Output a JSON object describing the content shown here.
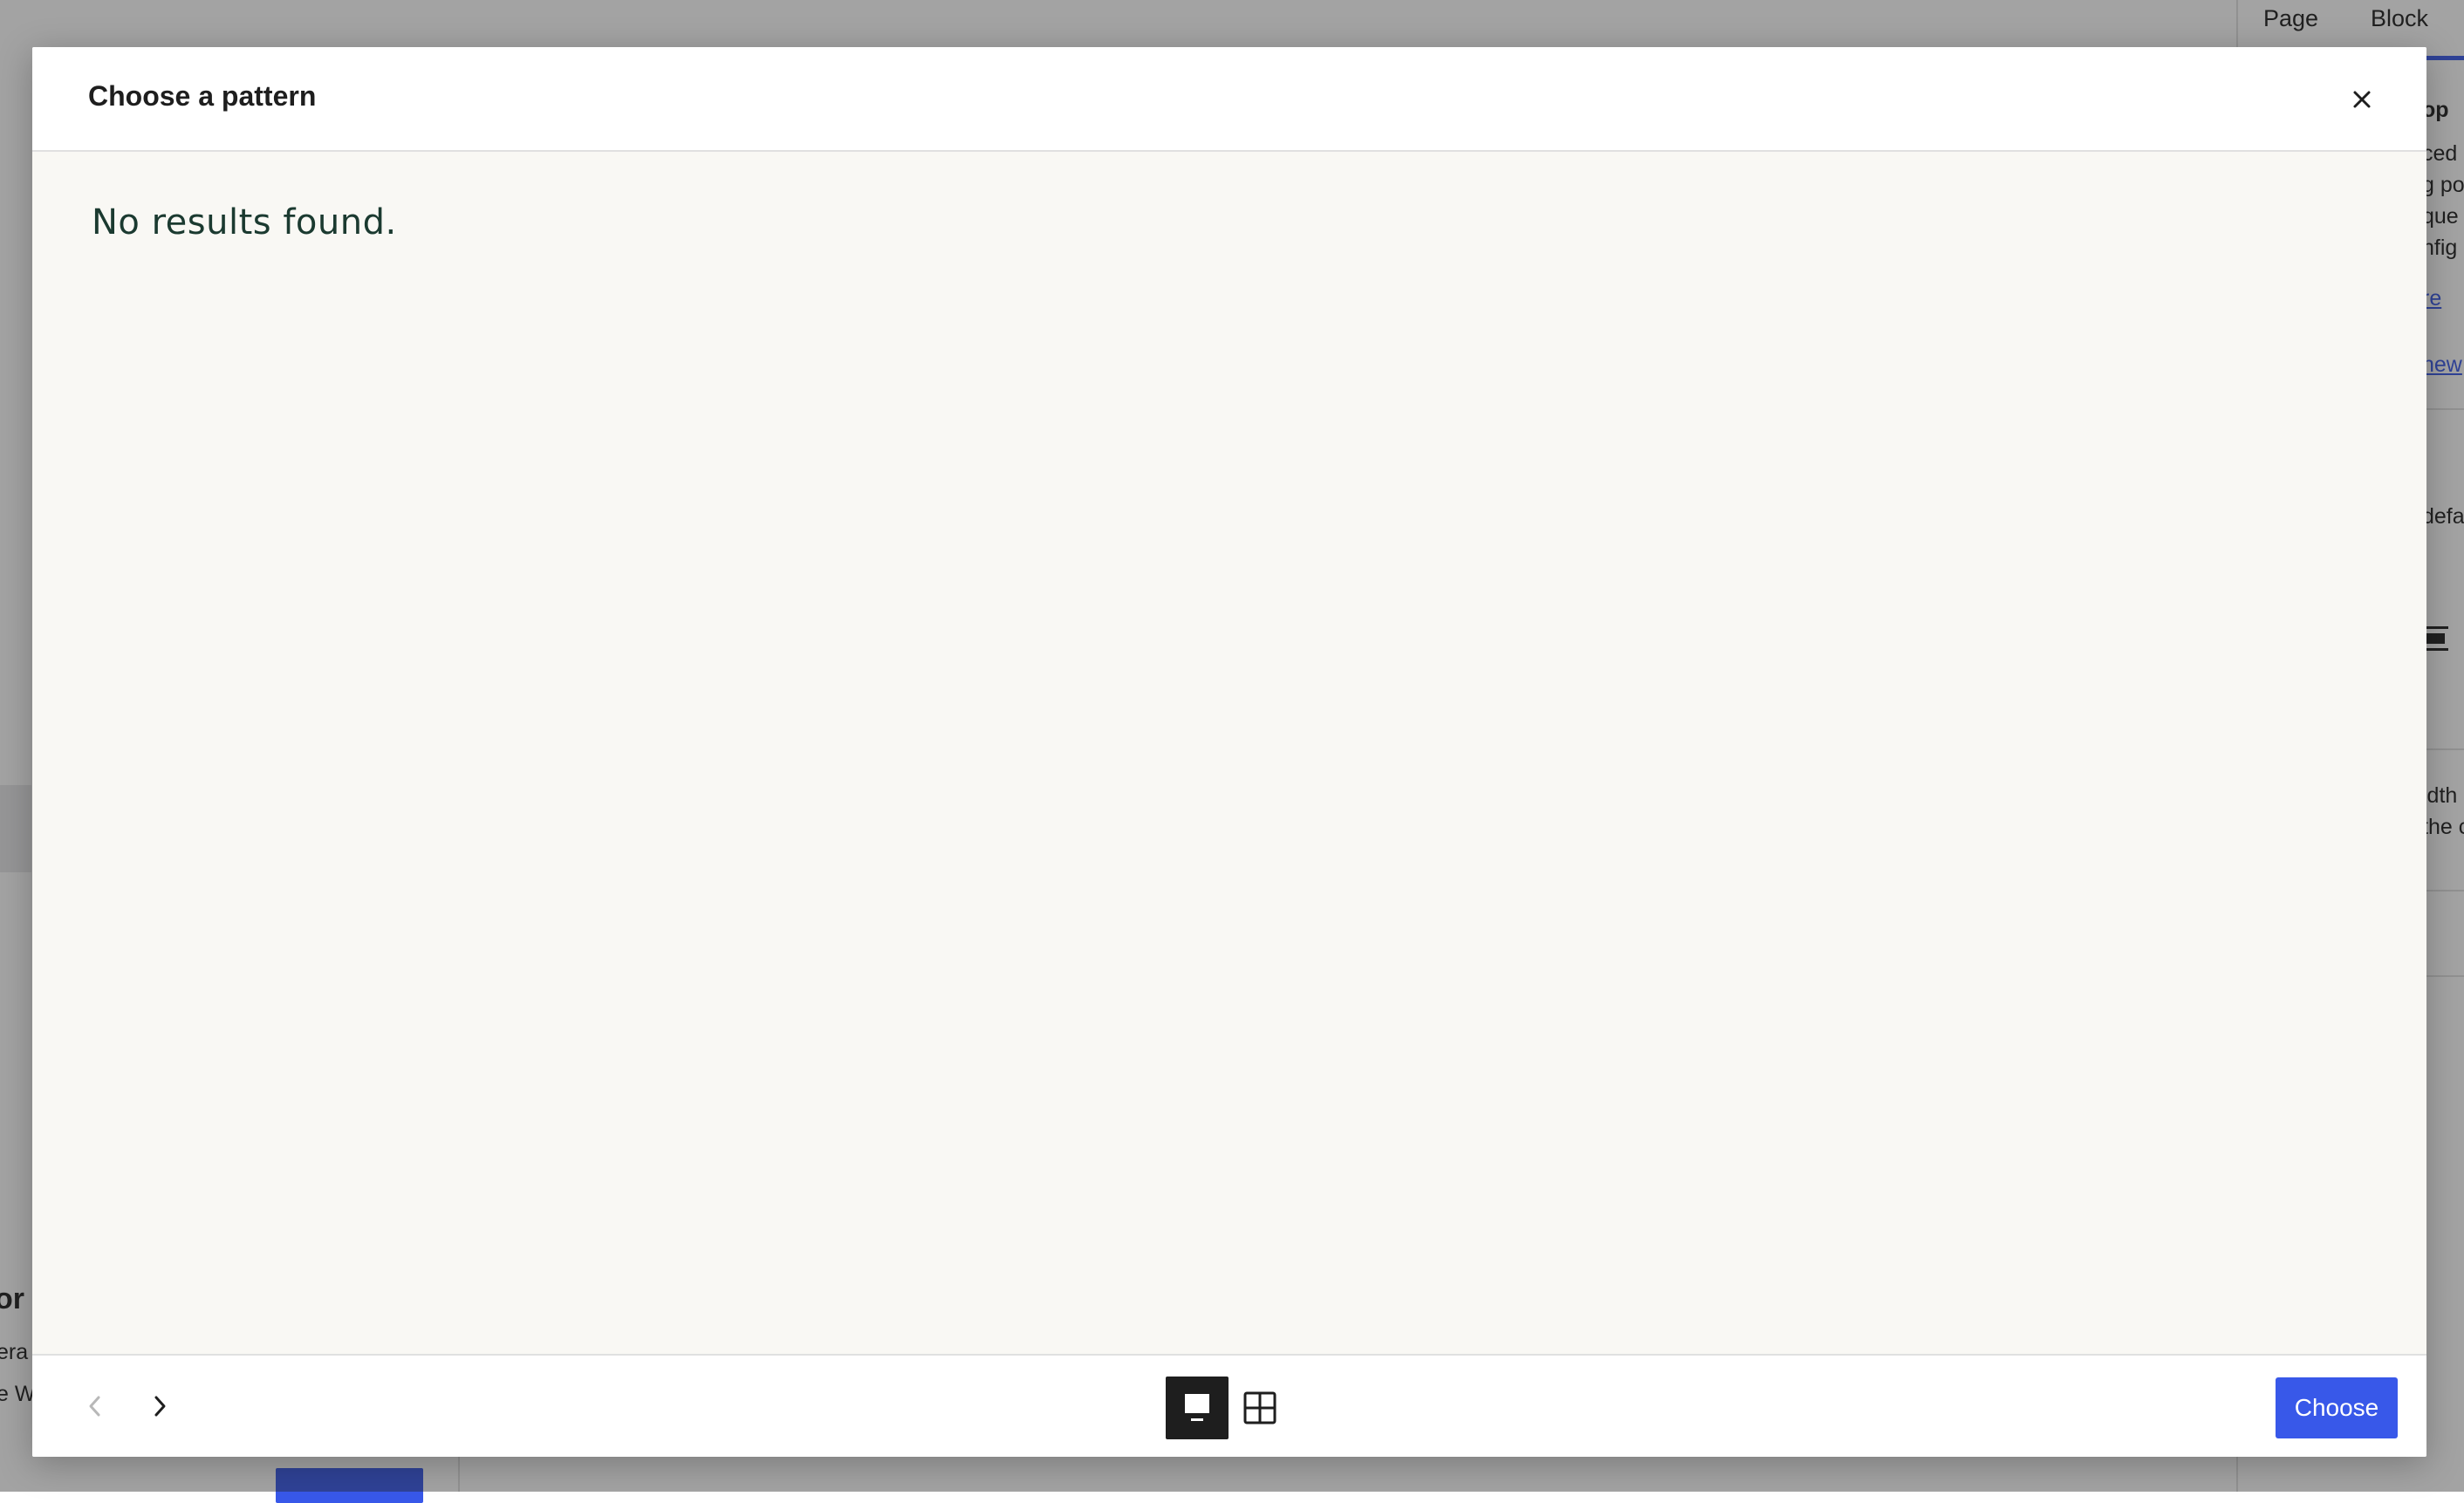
{
  "background": {
    "sidebar": {
      "tabs": [
        "Page",
        "Block"
      ],
      "fragments": {
        "top_label": "op",
        "line1": "ced",
        "line2": "g po",
        "line3": "que",
        "line4": "nfig",
        "link1": "re",
        "link2": "new",
        "default_text": "defa",
        "width_line1": "idth",
        "width_line2": "the c"
      }
    },
    "left": {
      "heading": "or",
      "line1": "era",
      "line2": "e W"
    }
  },
  "modal": {
    "title": "Choose a pattern",
    "close_label": "×",
    "empty_message": "No results found.",
    "footer": {
      "choose_label": "Choose",
      "active_view": "carousel"
    }
  },
  "icons": {
    "close": "close-icon",
    "prev": "chevron-left-icon",
    "next": "chevron-right-icon",
    "carousel_view": "carousel-view-icon",
    "grid_view": "grid-view-icon"
  },
  "colors": {
    "accent": "#3858e9",
    "overlay": "rgba(35,35,35,0.42)",
    "body_bg": "#f9f8f4",
    "empty_text": "#1b3a30"
  }
}
